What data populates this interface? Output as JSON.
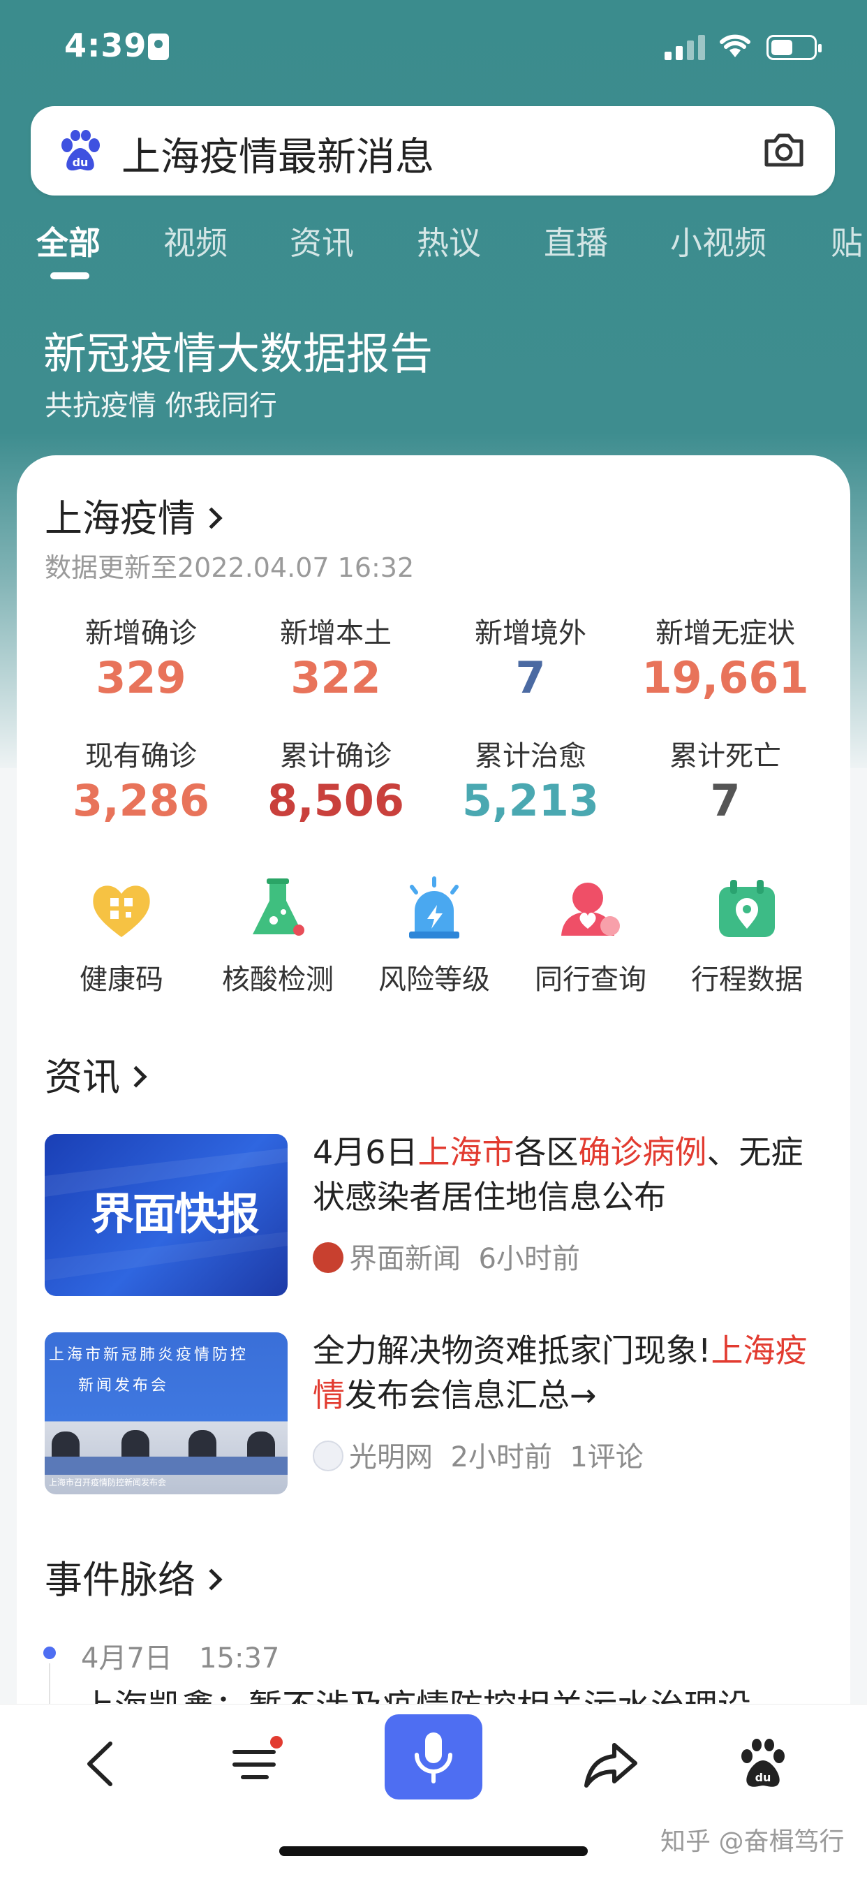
{
  "status_bar": {
    "time": "4:39"
  },
  "search": {
    "query": "上海疫情最新消息"
  },
  "tabs": [
    {
      "label": "全部"
    },
    {
      "label": "视频"
    },
    {
      "label": "资讯"
    },
    {
      "label": "热议"
    },
    {
      "label": "直播"
    },
    {
      "label": "小视频"
    },
    {
      "label": "贴"
    }
  ],
  "banner": {
    "title": "新冠疫情大数据报告",
    "subtitle": "共抗疫情 你我同行"
  },
  "covid_card": {
    "title": "上海疫情",
    "update_time": "数据更新至2022.04.07 16:32",
    "stats": [
      {
        "label": "新增确诊",
        "value": "329",
        "color": "#e8735a"
      },
      {
        "label": "新增本土",
        "value": "322",
        "color": "#e8735a"
      },
      {
        "label": "新增境外",
        "value": "7",
        "color": "#4b6aa2"
      },
      {
        "label": "新增无症状",
        "value": "19,661",
        "color": "#e8735a"
      },
      {
        "label": "现有确诊",
        "value": "3,286",
        "color": "#e8735a"
      },
      {
        "label": "累计确诊",
        "value": "8,506",
        "color": "#c9403c"
      },
      {
        "label": "累计治愈",
        "value": "5,213",
        "color": "#4aa8b1"
      },
      {
        "label": "累计死亡",
        "value": "7",
        "color": "#555555"
      }
    ],
    "tools": [
      {
        "label": "健康码",
        "icon": "qr-heart-icon"
      },
      {
        "label": "核酸检测",
        "icon": "flask-icon"
      },
      {
        "label": "风险等级",
        "icon": "alarm-light-icon"
      },
      {
        "label": "同行查询",
        "icon": "person-heart-icon"
      },
      {
        "label": "行程数据",
        "icon": "calendar-pin-icon"
      }
    ]
  },
  "news_section": {
    "title": "资讯",
    "items": [
      {
        "title_parts": [
          "4月6日",
          "上海市",
          "各区",
          "确诊病例",
          "、无症状感染者居住地信息公布"
        ],
        "thumb_text": "界面快报",
        "source": "界面新闻",
        "time": "6小时前"
      },
      {
        "title_parts": [
          "全力解决物资难抵家门现象!",
          "上海疫情",
          "发布会信息汇总→"
        ],
        "thumb_text_top": "上海市新冠肺炎疫情防控",
        "thumb_text_mid": "新闻发布会",
        "thumb_text_bottom": "上海市召开疫情防控新闻发布会",
        "source": "光明网",
        "time": "2小时前",
        "comments": "1评论"
      }
    ]
  },
  "timeline_section": {
    "title": "事件脉络",
    "date": "4月7日",
    "time": "15:37",
    "event": "上海凯鑫：暂不涉及疫情防控相关污水治理设"
  },
  "watermark": "知乎 @奋楫笃行",
  "colors": {
    "header_teal": "#3e8d8f",
    "accent_blue": "#4e6ef2",
    "highlight_red": "#e23b30"
  }
}
